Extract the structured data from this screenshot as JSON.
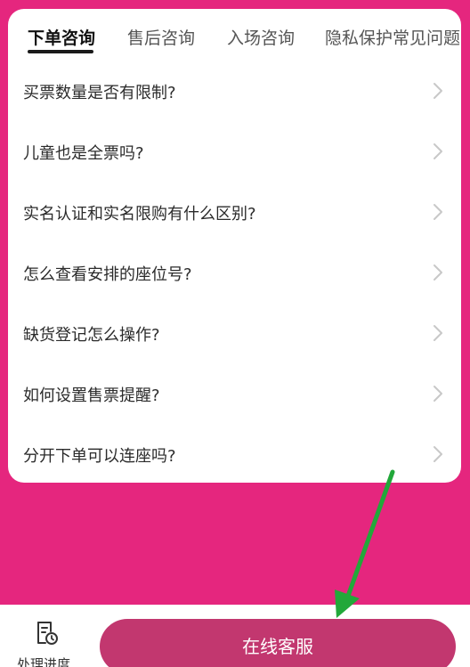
{
  "tabs": [
    {
      "label": "下单咨询",
      "active": true
    },
    {
      "label": "售后咨询",
      "active": false
    },
    {
      "label": "入场咨询",
      "active": false
    },
    {
      "label": "隐私保护常见问题",
      "active": false
    }
  ],
  "faq": [
    "买票数量是否有限制?",
    "儿童也是全票吗?",
    "实名认证和实名限购有什么区别?",
    "怎么查看安排的座位号?",
    "缺货登记怎么操作?",
    "如何设置售票提醒?",
    "分开下单可以连座吗?"
  ],
  "bottom": {
    "progress_label": "处理进度",
    "service_label": "在线客服"
  },
  "colors": {
    "background": "#e5267e",
    "service_button": "#c2376f",
    "annotation_arrow": "#22a83a"
  },
  "icons": {
    "chevron": "chevron-right-icon",
    "progress": "document-clock-icon"
  }
}
